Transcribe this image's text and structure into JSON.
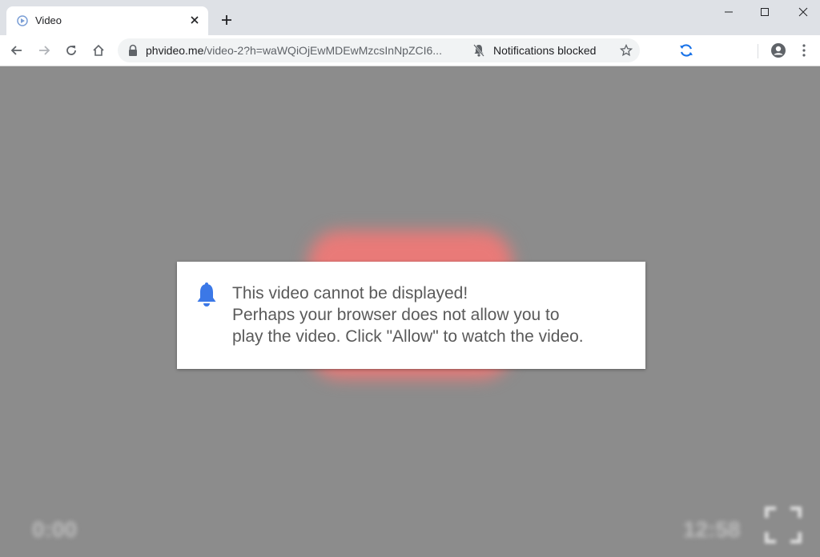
{
  "browser": {
    "tab_title": "Video",
    "url_host": "phvideo.me",
    "url_path": "/video-2?h=waWQiOjEwMDEwMzcsInNpZCI6...",
    "notifications_label": "Notifications blocked"
  },
  "dialog": {
    "line1": "This video cannot be displayed!",
    "line2": "Perhaps your browser does not allow you to",
    "line3": "play the video. Click \"Allow\" to watch the video."
  },
  "player": {
    "current_time": "0:00",
    "duration": "12:58"
  },
  "colors": {
    "bell": "#3b78e7",
    "video_bg": "#8c8c8c",
    "play_button": "#e97a78"
  },
  "icons": [
    "tab-favicon",
    "close-icon",
    "plus-icon",
    "minimize-icon",
    "maximize-icon",
    "close-window-icon",
    "back-icon",
    "forward-icon",
    "reload-icon",
    "home-icon",
    "lock-icon",
    "bell-off-icon",
    "star-icon",
    "sync-icon",
    "profile-icon",
    "menu-icon",
    "bell-icon",
    "fullscreen-icon"
  ]
}
